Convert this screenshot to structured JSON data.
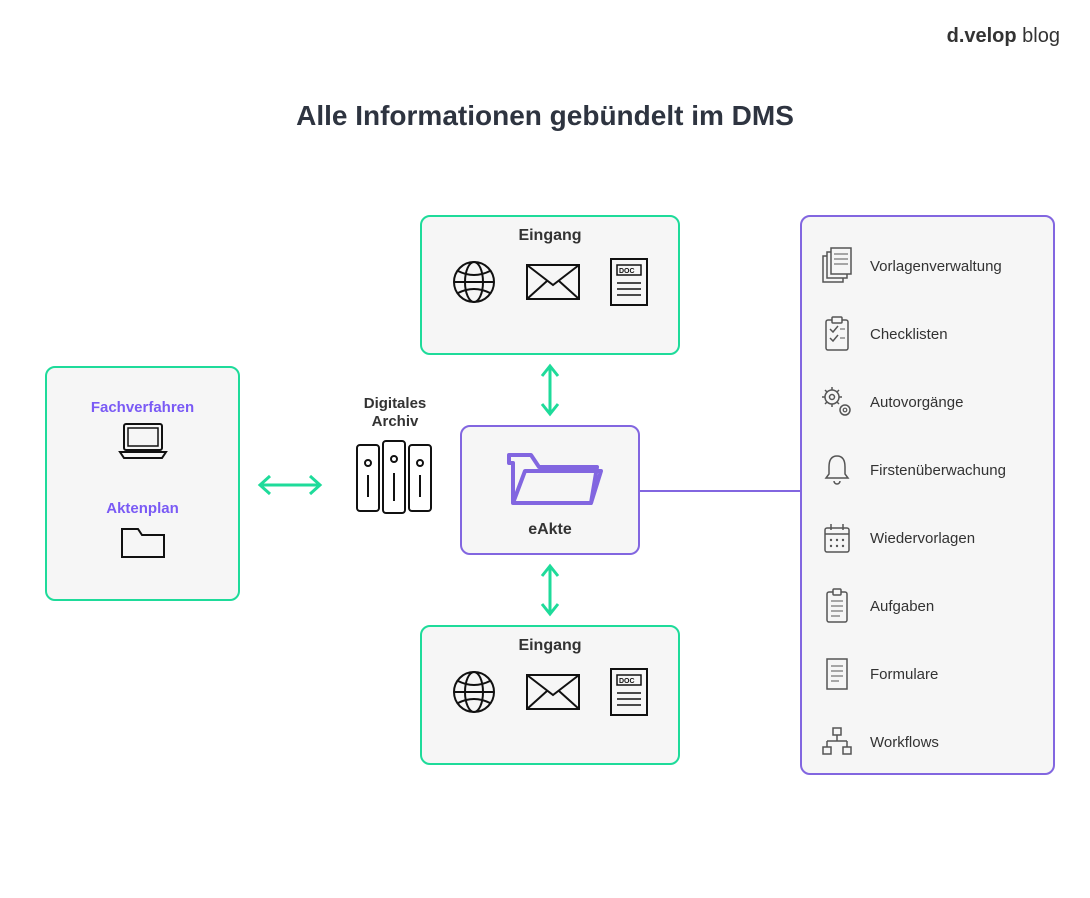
{
  "brand": {
    "name_bold": "d.velop",
    "name_light": " blog"
  },
  "title": "Alle Informationen gebündelt im DMS",
  "left_box": {
    "item1_label": "Fachverfahren",
    "item2_label": "Aktenplan"
  },
  "archive": {
    "label_line1": "Digitales",
    "label_line2": "Archiv"
  },
  "eakte": {
    "label": "eAkte"
  },
  "eingang_top": {
    "title": "Eingang"
  },
  "eingang_bottom": {
    "title": "Eingang"
  },
  "right_panel": {
    "items": [
      {
        "label": "Vorlagenverwaltung"
      },
      {
        "label": "Checklisten"
      },
      {
        "label": "Autovorgänge"
      },
      {
        "label": "Firstenüberwachung"
      },
      {
        "label": "Wiedervorlagen"
      },
      {
        "label": "Aufgaben"
      },
      {
        "label": "Formulare"
      },
      {
        "label": "Workflows"
      }
    ]
  },
  "colors": {
    "green": "#1edb9a",
    "purple": "#8266e0"
  }
}
